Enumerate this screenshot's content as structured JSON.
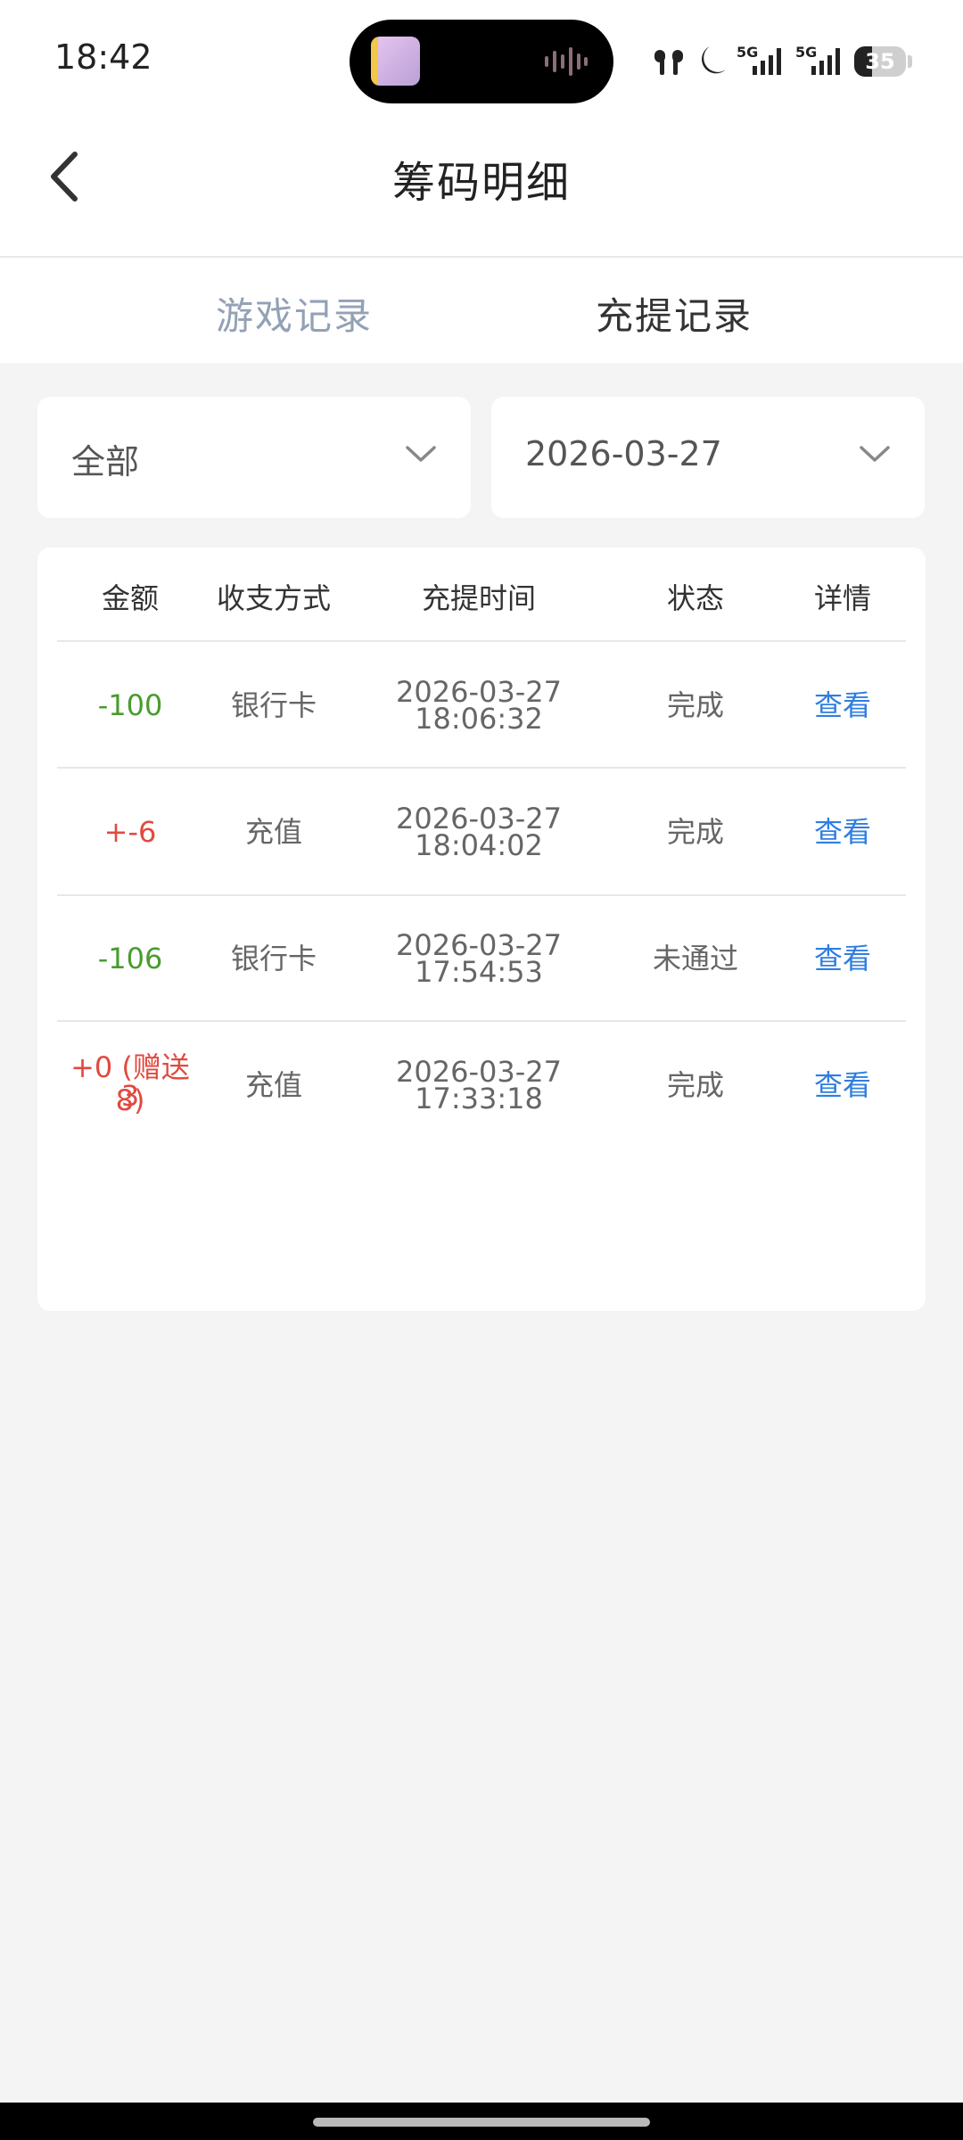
{
  "status": {
    "time": "18:42",
    "network_1": "5G",
    "network_2": "5G",
    "battery_level": 35
  },
  "header": {
    "title": "筹码明细"
  },
  "tabs": [
    {
      "label": "游戏记录",
      "active": false
    },
    {
      "label": "充提记录",
      "active": true
    }
  ],
  "filters": {
    "type": "全部",
    "date": "2026-03-27"
  },
  "table": {
    "headers": [
      "金额",
      "收支方式",
      "充提时间",
      "状态",
      "详情"
    ],
    "rows": [
      {
        "amount": "-100",
        "method": "银行卡",
        "date": "2026-03-27",
        "time": "18:06:32",
        "status": "完成",
        "detail": "查看"
      },
      {
        "amount": "+-6",
        "method": "充值",
        "date": "2026-03-27",
        "time": "18:04:02",
        "status": "完成",
        "detail": "查看"
      },
      {
        "amount": "-106",
        "method": "银行卡",
        "date": "2026-03-27",
        "time": "17:54:53",
        "status": "未通过",
        "detail": "查看"
      },
      {
        "amount_line1": "+0 (赠送3",
        "amount_line2": "8)",
        "method": "充值",
        "date": "2026-03-27",
        "time": "17:33:18",
        "status": "完成",
        "detail": "查看"
      }
    ]
  },
  "colors": {
    "negative": "#4a9b2f",
    "positive": "#e2493f",
    "link": "#2f7ee0",
    "inactive_tab": "#93a1b5"
  }
}
